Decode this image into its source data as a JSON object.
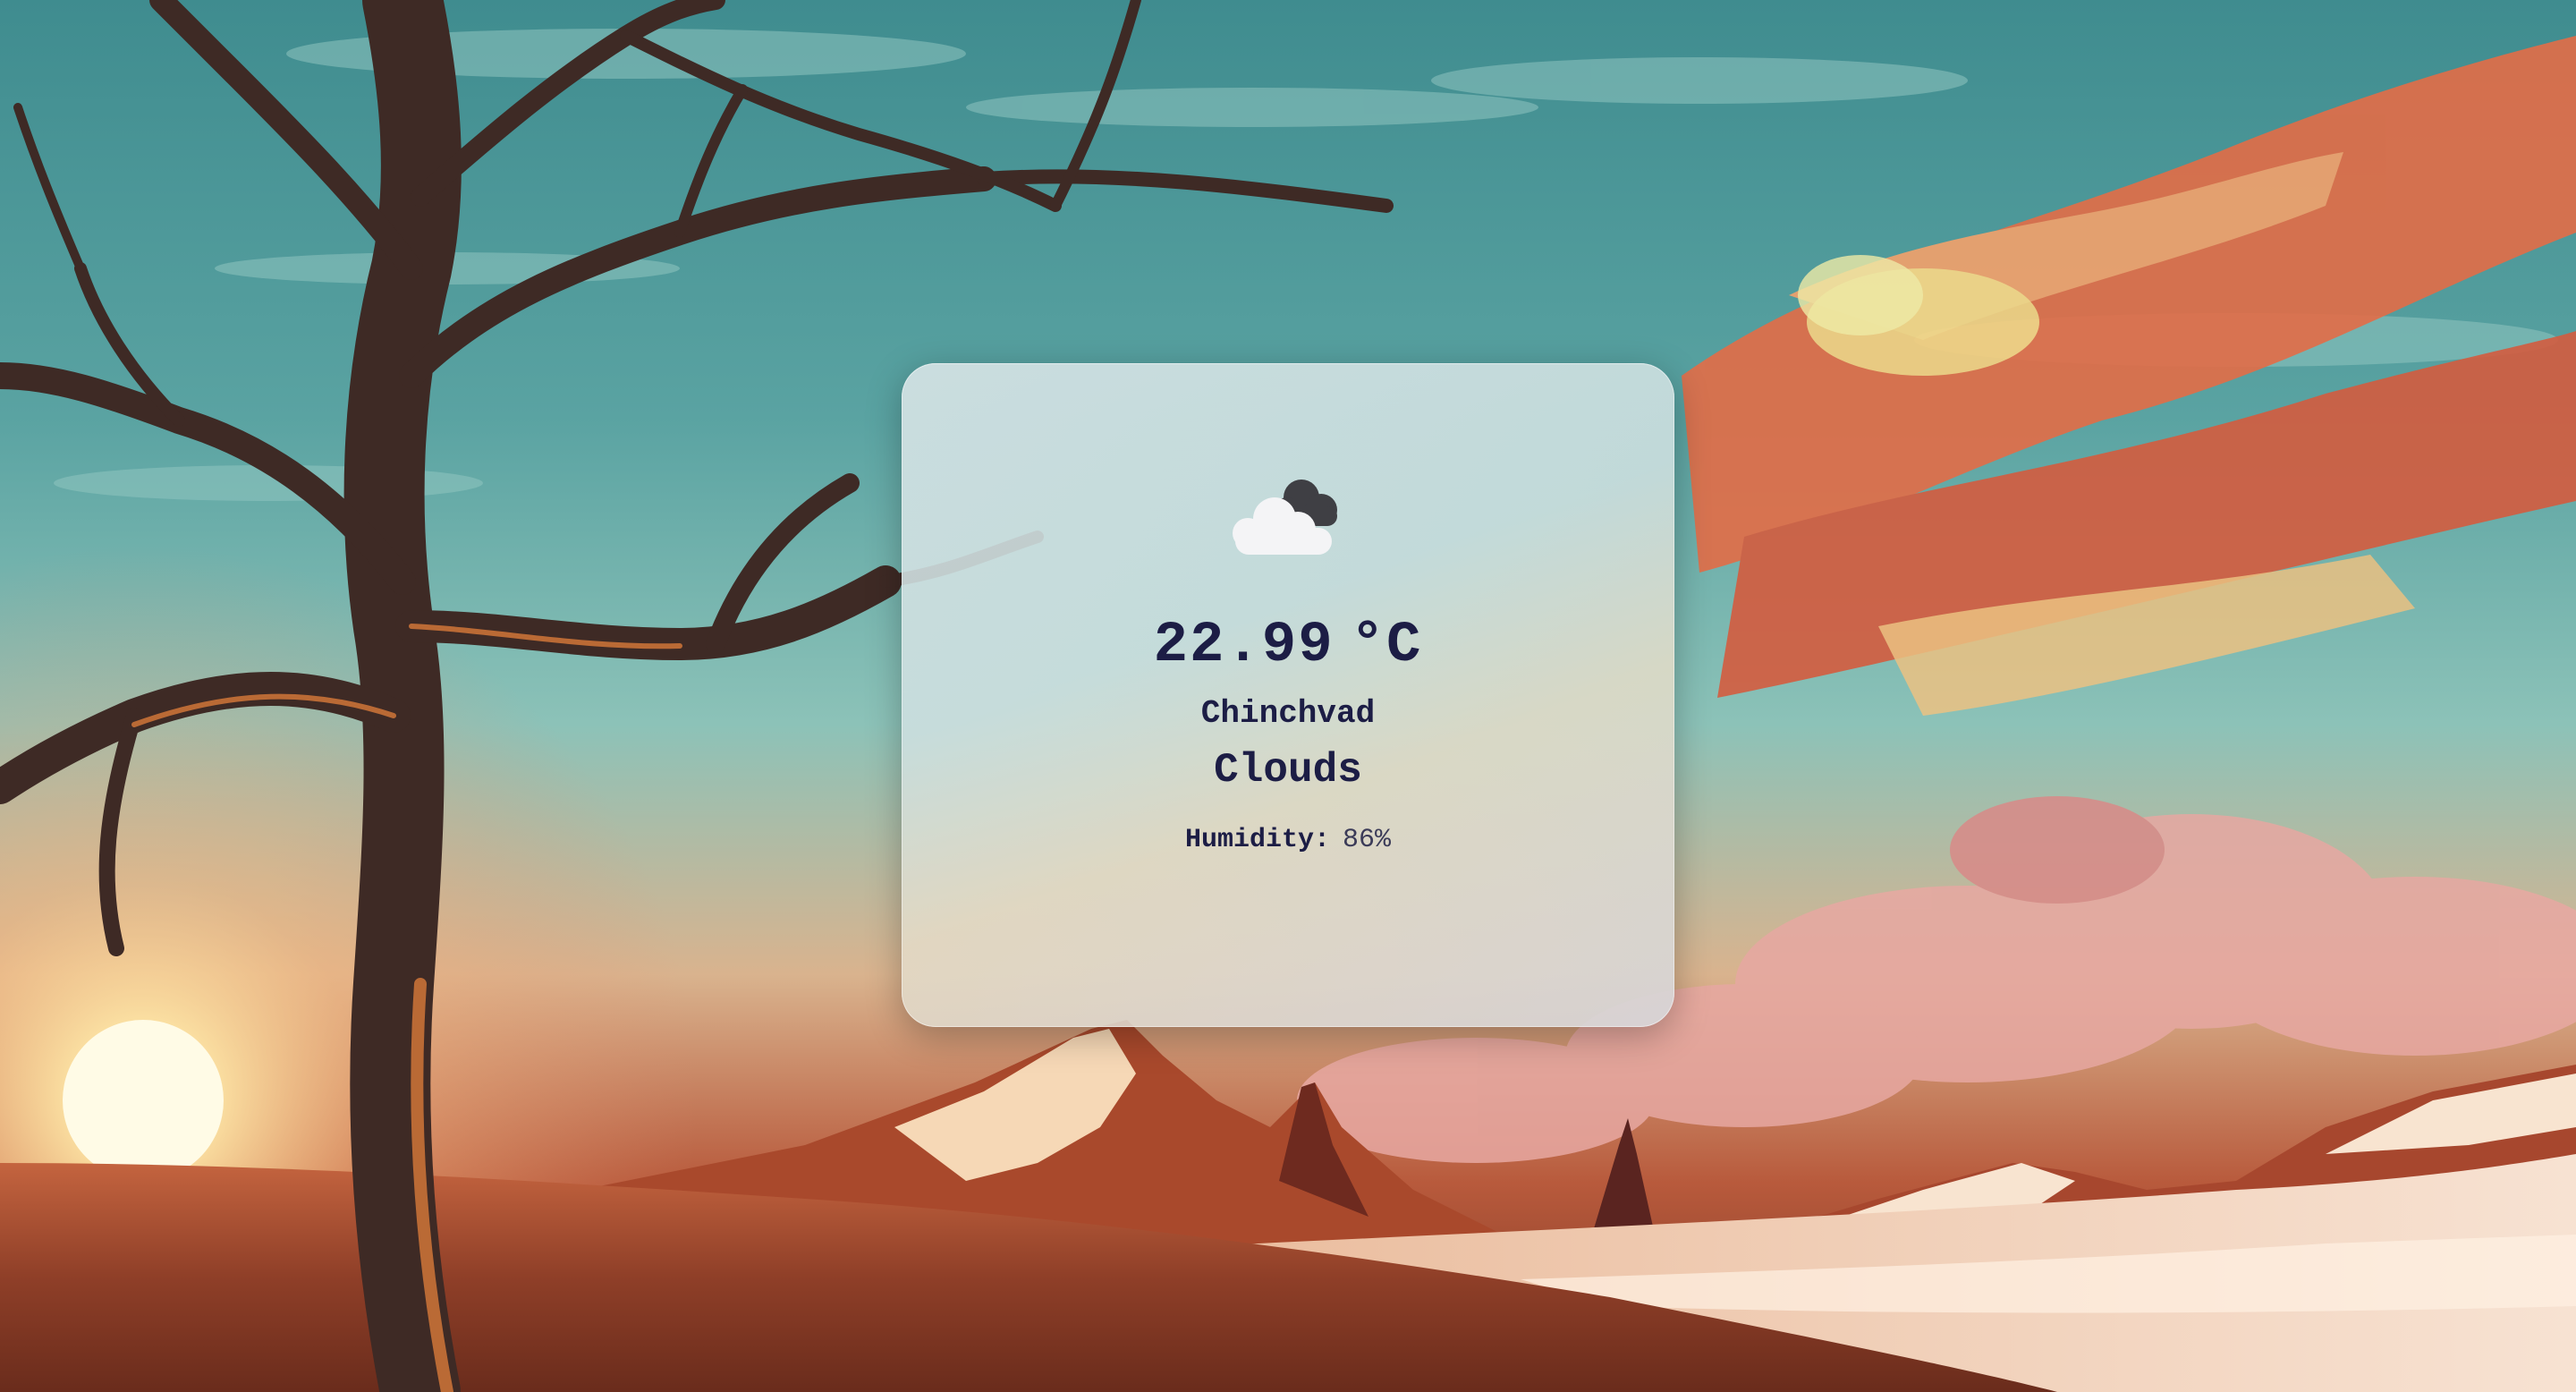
{
  "background": {
    "name": "painted-landscape-wallpaper",
    "colors": {
      "sky": "#5aa3a2",
      "cloud_orange": "#e9754a",
      "sun": "#fff3c4",
      "ground": "#b85a3c",
      "snow": "#f5dcc8"
    }
  },
  "weather": {
    "icon": "cloud-icon",
    "temperature": "22.99",
    "unit": "°C",
    "city": "Chinchvad",
    "condition": "Clouds",
    "humidity_label": "Humidity:",
    "humidity_value": "86%"
  },
  "theme": {
    "text_color": "#1c1d45",
    "card_color": "#d7e4e6"
  }
}
